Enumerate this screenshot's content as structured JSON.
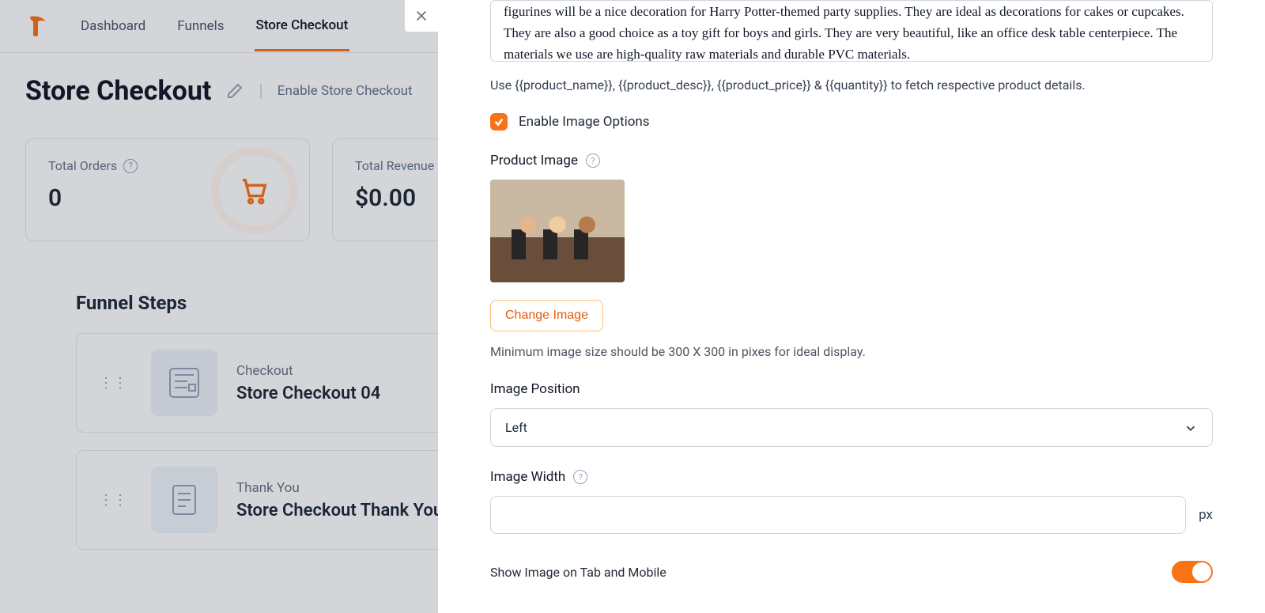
{
  "nav": {
    "items": [
      "Dashboard",
      "Funnels",
      "Store Checkout"
    ],
    "active_index": 2
  },
  "page": {
    "title": "Store Checkout",
    "enable_label": "Enable Store Checkout"
  },
  "metrics": {
    "orders": {
      "label": "Total Orders",
      "value": "0"
    },
    "revenue": {
      "label": "Total Revenue",
      "value": "$0.00"
    }
  },
  "funnel": {
    "heading": "Funnel Steps",
    "steps": [
      {
        "small": "Checkout",
        "big": "Store Checkout 04"
      },
      {
        "small": "Thank You",
        "big": "Store Checkout Thank You"
      }
    ]
  },
  "drawer": {
    "description_text": "figurines will be a nice decoration for Harry Potter-themed party supplies. They are ideal as decorations for cakes or cupcakes. They are also a good choice as a toy gift for boys and girls. They are very beautiful, like an office desk table centerpiece. The materials we use are high-quality raw materials and durable PVC materials.",
    "placeholders_hint": "Use {{product_name}}, {{product_desc}}, {{product_price}} & {{quantity}} to fetch respective product details.",
    "enable_image_options": {
      "label": "Enable Image Options",
      "checked": true
    },
    "product_image_label": "Product Image",
    "change_image_btn": "Change Image",
    "min_size_hint": "Minimum image size should be 300 X 300 in pixes for ideal display.",
    "image_position": {
      "label": "Image Position",
      "value": "Left"
    },
    "image_width": {
      "label": "Image Width",
      "value": "",
      "unit": "px"
    },
    "show_on_mobile": {
      "label": "Show Image on Tab and Mobile",
      "on": true
    }
  }
}
